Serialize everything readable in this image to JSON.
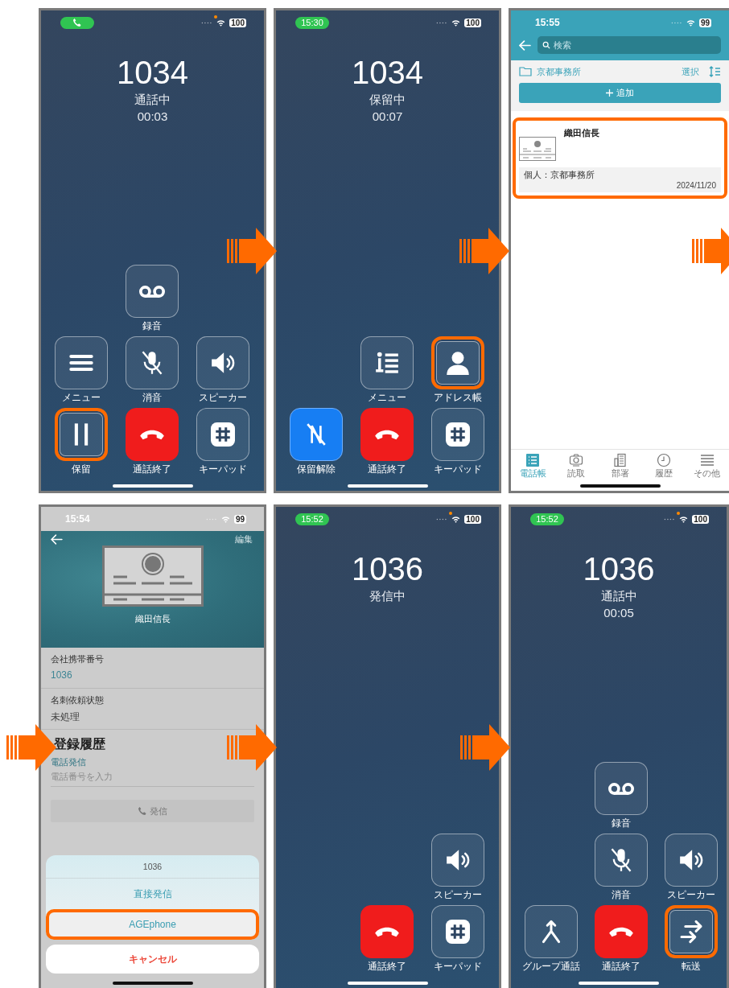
{
  "screens": [
    {
      "kind": "call",
      "status": {
        "pill": true,
        "battery": "100",
        "mic_dot": true
      },
      "number": "1034",
      "state": "通話中",
      "timer": "00:03",
      "rows": [
        {
          "center": {
            "kind": "voicemail",
            "label": "録音",
            "highlighted": false
          }
        },
        {
          "left": {
            "kind": "menu",
            "label": "メニュー",
            "highlighted": false
          },
          "center": {
            "kind": "mute",
            "label": "消音",
            "highlighted": false
          },
          "right": {
            "kind": "speaker",
            "label": "スピーカー",
            "highlighted": false
          }
        },
        {
          "left": {
            "kind": "hold",
            "label": "保留",
            "highlighted": true
          },
          "center": {
            "kind": "end",
            "label": "通話終了",
            "highlighted": false
          },
          "right": {
            "kind": "keypad",
            "label": "キーパッド",
            "highlighted": false
          }
        }
      ]
    },
    {
      "kind": "call",
      "status": {
        "pill": true,
        "time": "15:30",
        "battery": "100",
        "mic_dot": false
      },
      "number": "1034",
      "state": "保留中",
      "timer": "00:07",
      "rows": [
        {
          "center": {
            "kind": "list",
            "label": "メニュー",
            "highlighted": false
          },
          "right": {
            "kind": "contact",
            "label": "アドレス帳",
            "highlighted": true
          }
        },
        {
          "left": {
            "kind": "unhold",
            "label": "保留解除",
            "highlighted": false
          },
          "center": {
            "kind": "end",
            "label": "通話終了",
            "highlighted": false
          },
          "right": {
            "kind": "keypad",
            "label": "キーパッド",
            "highlighted": false
          }
        }
      ]
    },
    {
      "kind": "address_book",
      "status": {
        "pill": false,
        "time": "15:55",
        "battery": "99",
        "mic_dot": false
      },
      "search": {
        "placeholder": "検索"
      },
      "folder": "京都事務所",
      "select_label": "選択",
      "add_label": "追加",
      "cards": [
        {
          "name": "織田信長",
          "note": "個人：京都事務所",
          "date": "2024/11/20",
          "highlighted": true
        }
      ],
      "tabs": [
        {
          "kind": "list",
          "label": "電話帳",
          "selected": true
        },
        {
          "kind": "camera",
          "label": "読取",
          "selected": false
        },
        {
          "kind": "building",
          "label": "部署",
          "selected": false
        },
        {
          "kind": "clock",
          "label": "履歴",
          "selected": false
        },
        {
          "kind": "more",
          "label": "その他",
          "selected": false
        }
      ]
    },
    {
      "kind": "contact",
      "status": {
        "pill": false,
        "time": "15:54",
        "battery": "99",
        "mic_dot": false
      },
      "edit_label": "編集",
      "name": "織田信長",
      "fields": [
        {
          "kind": "link",
          "label": "会社携帯番号",
          "value": "1036"
        },
        {
          "kind": "plain",
          "label": "名刺依頼状態",
          "value": "未処理"
        }
      ],
      "section_title": "登録履歴",
      "phone_input": {
        "label": "電話発信",
        "placeholder": "電話番号を入力"
      },
      "call_button": {
        "label": "発信",
        "disabled": true
      },
      "action_sheet": {
        "title": "1036",
        "options": [
          {
            "label": "直接発信",
            "highlighted": false
          },
          {
            "label": "AGEphone",
            "highlighted": true
          }
        ],
        "cancel": "キャンセル"
      }
    },
    {
      "kind": "call",
      "status": {
        "pill": true,
        "time": "15:52",
        "battery": "100",
        "mic_dot": true
      },
      "number": "1036",
      "state": "発信中",
      "rows": [
        {
          "right": {
            "kind": "speaker",
            "label": "スピーカー",
            "highlighted": false
          }
        },
        {
          "center": {
            "kind": "end",
            "label": "通話終了",
            "highlighted": false
          },
          "right": {
            "kind": "keypad",
            "label": "キーパッド",
            "highlighted": false
          }
        }
      ]
    },
    {
      "kind": "call",
      "status": {
        "pill": true,
        "time": "15:52",
        "battery": "100",
        "mic_dot": true
      },
      "number": "1036",
      "state": "通話中",
      "timer": "00:05",
      "rows": [
        {
          "center": {
            "kind": "voicemail",
            "label": "録音",
            "highlighted": false
          }
        },
        {
          "center": {
            "kind": "mute",
            "label": "消音",
            "highlighted": false
          },
          "right": {
            "kind": "speaker",
            "label": "スピーカー",
            "highlighted": false
          }
        },
        {
          "left": {
            "kind": "merge",
            "label": "グループ通話",
            "highlighted": false
          },
          "center": {
            "kind": "end",
            "label": "通話終了",
            "highlighted": false
          },
          "right": {
            "kind": "transfer",
            "label": "転送",
            "highlighted": true
          }
        }
      ]
    }
  ]
}
